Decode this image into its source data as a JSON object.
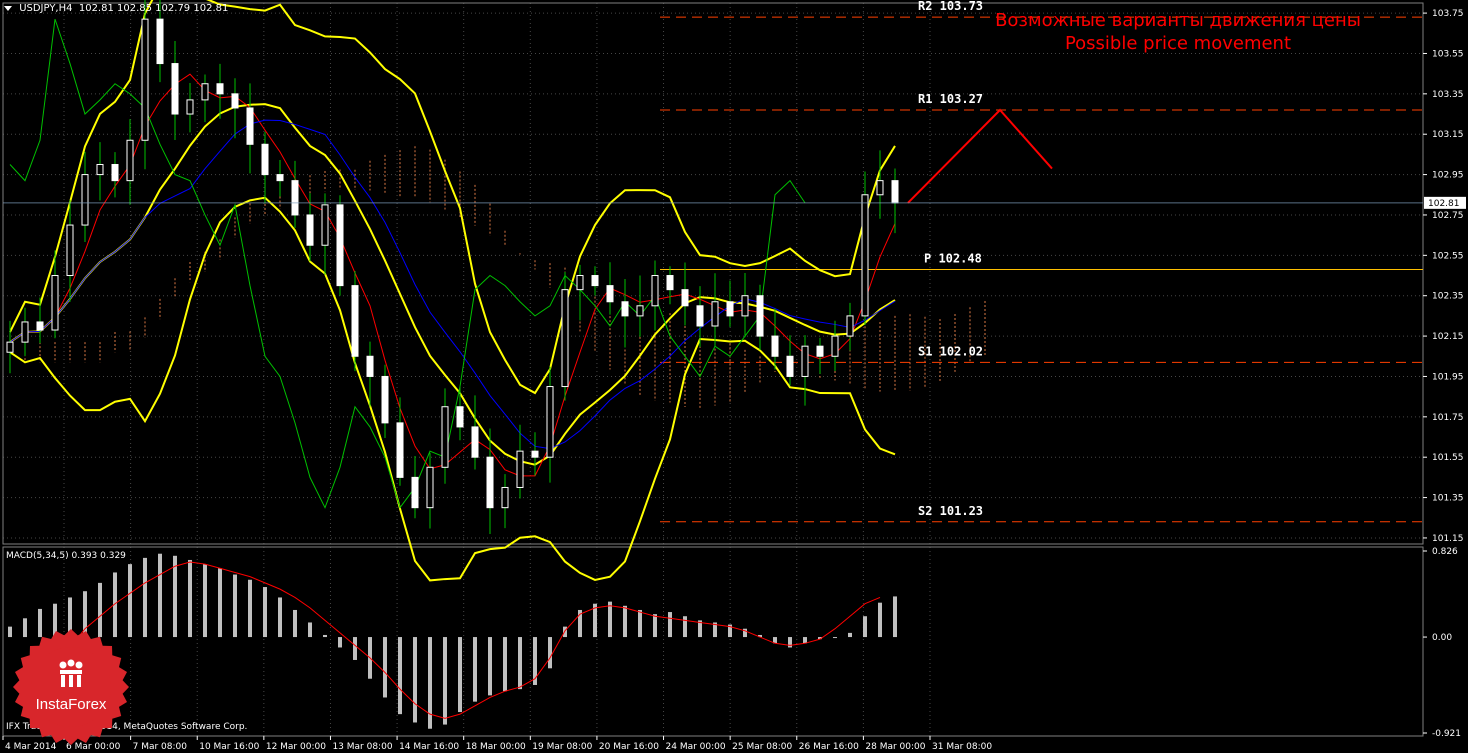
{
  "header": {
    "symbol_timeframe": "USDJPY,H4",
    "ohlc": "102.81 102.85 102.79 102.81"
  },
  "annotation": {
    "line1": "Возможные варианты движения цены",
    "line2": "Possible price movement"
  },
  "current_price": "102.81",
  "macd": {
    "label": "MACD(5,34,5)",
    "values": "0.393 0.329",
    "axis": [
      "0.826",
      "0.00",
      "-0.921"
    ]
  },
  "copyright": "IFX Trader, © 2001-2014, MetaQuotes Software Corp.",
  "logo_text": "InstaForex",
  "colors": {
    "background": "#000000",
    "grid": "#808080",
    "candle": "#ffffff",
    "bollinger": "#ffff00",
    "tenkan": "#ff0000",
    "kijun": "#0000ff",
    "chikou": "#00c000",
    "cloud": "#ff8c50",
    "levels": "#ff4000",
    "pivot": "#ffc000",
    "forecast": "#ff0000"
  },
  "chart_data": {
    "type": "candlestick",
    "symbol": "USDJPY",
    "timeframe": "H4",
    "price_axis": [
      "103.75",
      "103.55",
      "103.35",
      "103.15",
      "102.95",
      "102.75",
      "102.55",
      "102.35",
      "102.15",
      "101.95",
      "101.75",
      "101.55",
      "101.35",
      "101.15"
    ],
    "price_range": [
      101.12,
      103.8
    ],
    "time_axis": [
      "4 Mar 2014",
      "6 Mar 00:00",
      "7 Mar 08:00",
      "10 Mar 16:00",
      "12 Mar 00:00",
      "13 Mar 08:00",
      "14 Mar 16:00",
      "18 Mar 00:00",
      "19 Mar 08:00",
      "20 Mar 16:00",
      "24 Mar 00:00",
      "25 Mar 08:00",
      "26 Mar 16:00",
      "28 Mar 00:00",
      "31 Mar 08:00"
    ],
    "levels": [
      {
        "name": "R2",
        "text": "R2 103.73",
        "value": 103.73
      },
      {
        "name": "R1",
        "text": "R1 103.27",
        "value": 103.27
      },
      {
        "name": "P",
        "text": "P 102.48",
        "value": 102.48
      },
      {
        "name": "S1",
        "text": "S1 102.02",
        "value": 102.02
      },
      {
        "name": "S2",
        "text": "S2 101.23",
        "value": 101.23
      }
    ],
    "forecast_path": [
      102.81,
      103.27,
      102.98
    ],
    "close_series": [
      102.12,
      102.22,
      102.18,
      102.45,
      102.7,
      102.95,
      103.0,
      102.92,
      103.12,
      103.72,
      103.5,
      103.25,
      103.32,
      103.4,
      103.35,
      103.28,
      103.1,
      102.95,
      102.92,
      102.75,
      102.6,
      102.8,
      102.4,
      102.05,
      101.95,
      101.72,
      101.45,
      101.3,
      101.5,
      101.8,
      101.7,
      101.55,
      101.3,
      101.4,
      101.58,
      101.55,
      101.9,
      102.38,
      102.45,
      102.4,
      102.32,
      102.25,
      102.3,
      102.45,
      102.38,
      102.3,
      102.2,
      102.32,
      102.25,
      102.35,
      102.15,
      102.05,
      101.95,
      102.1,
      102.05,
      102.15,
      102.25,
      102.85,
      102.92,
      102.81
    ],
    "macd_hist": [
      0.1,
      0.18,
      0.27,
      0.32,
      0.38,
      0.44,
      0.52,
      0.62,
      0.7,
      0.76,
      0.8,
      0.78,
      0.74,
      0.7,
      0.66,
      0.6,
      0.55,
      0.48,
      0.38,
      0.26,
      0.14,
      0.02,
      -0.1,
      -0.22,
      -0.4,
      -0.58,
      -0.74,
      -0.82,
      -0.88,
      -0.84,
      -0.72,
      -0.62,
      -0.56,
      -0.52,
      -0.5,
      -0.46,
      -0.3,
      0.1,
      0.26,
      0.32,
      0.34,
      0.3,
      0.26,
      0.22,
      0.24,
      0.2,
      0.16,
      0.14,
      0.12,
      0.08,
      0.02,
      -0.06,
      -0.1,
      -0.06,
      -0.02,
      0.0,
      0.04,
      0.2,
      0.33,
      0.39
    ],
    "macd_signal": [
      -0.3,
      -0.1,
      0.08,
      0.2,
      0.32,
      0.42,
      0.52,
      0.6,
      0.68,
      0.72,
      0.7,
      0.66,
      0.62,
      0.58,
      0.52,
      0.46,
      0.38,
      0.28,
      0.16,
      0.04,
      -0.08,
      -0.2,
      -0.34,
      -0.5,
      -0.64,
      -0.74,
      -0.78,
      -0.74,
      -0.66,
      -0.58,
      -0.52,
      -0.48,
      -0.4,
      -0.2,
      0.06,
      0.22,
      0.28,
      0.3,
      0.28,
      0.24,
      0.2,
      0.18,
      0.16,
      0.14,
      0.12,
      0.1,
      0.06,
      0.0,
      -0.06,
      -0.08,
      -0.06,
      -0.02,
      0.08,
      0.2,
      0.32,
      0.38
    ]
  }
}
